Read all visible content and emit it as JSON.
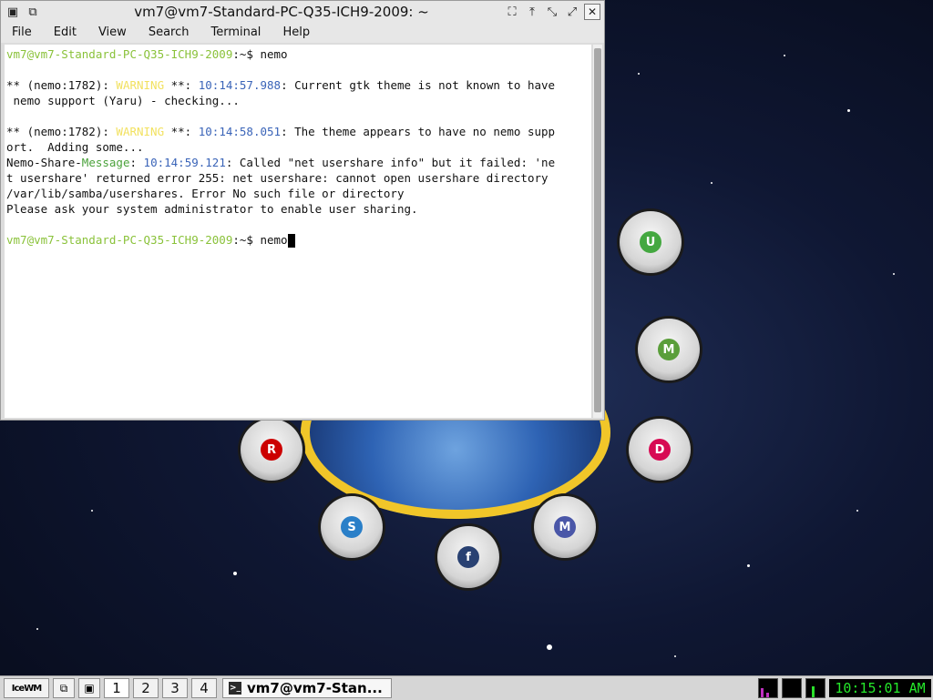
{
  "window": {
    "title": "vm7@vm7-Standard-PC-Q35-ICH9-2009: ~",
    "menu": [
      "File",
      "Edit",
      "View",
      "Search",
      "Terminal",
      "Help"
    ]
  },
  "terminal": {
    "prompt": "vm7@vm7-Standard-PC-Q35-ICH9-2009",
    "prompt_suffix": ":~$ ",
    "command1": "nemo",
    "l1_prefix": "** (nemo:1782): ",
    "l1_warn": "WARNING",
    "l1_mid": " **: ",
    "l1_time": "10:14:57.988",
    "l1_text": ": Current gtk theme is not known to have",
    "l2_text": " nemo support (Yaru) - checking...",
    "l3_prefix": "** (nemo:1782): ",
    "l3_warn": "WARNING",
    "l3_mid": " **: ",
    "l3_time": "10:14:58.051",
    "l3_text": ": The theme appears to have no nemo supp",
    "l4_text": "ort.  Adding some...",
    "l5_prefix": "Nemo-Share-",
    "l5_msg": "Message",
    "l5_mid": ": ",
    "l5_time": "10:14:59.121",
    "l5_text": ": Called \"net usershare info\" but it failed: 'ne",
    "l6_text": "t usershare' returned error 255: net usershare: cannot open usershare directory",
    "l7_text": "/var/lib/samba/usershares. Error No such file or directory",
    "l8_text": "Please ask your system administrator to enable user sharing.",
    "command2": "nemo"
  },
  "taskbar": {
    "start_label": "IceWM",
    "desktops": [
      "1",
      "2",
      "3",
      "4"
    ],
    "active_task": "vm7@vm7-Stan...",
    "clock": "10:15:01 AM"
  },
  "colors": {
    "prompt": "#8ac23a",
    "warning": "#f2e160",
    "timestamp": "#3a64b8",
    "message": "#4aa23a",
    "clock_fg": "#25e82a"
  }
}
